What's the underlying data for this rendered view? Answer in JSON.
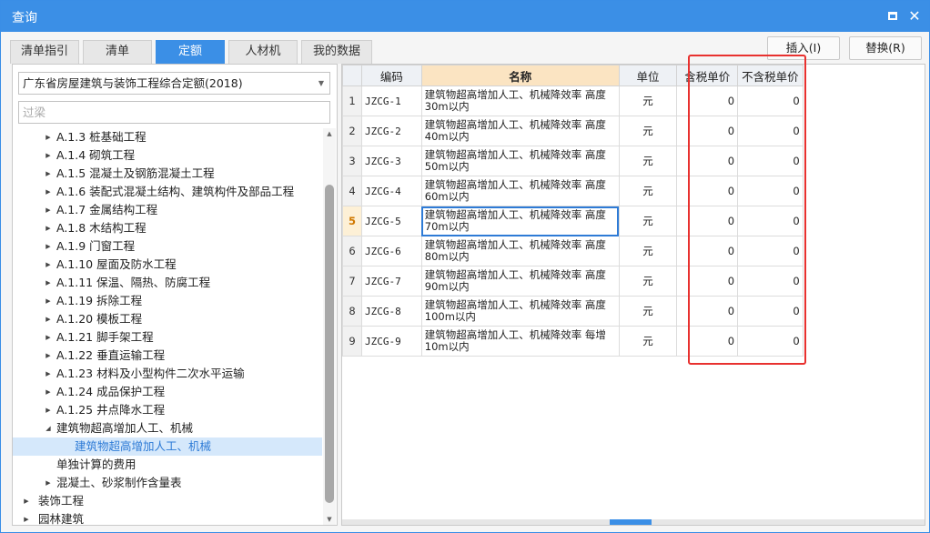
{
  "window": {
    "title": "查询"
  },
  "tabs": [
    {
      "label": "清单指引",
      "active": false
    },
    {
      "label": "清单",
      "active": false
    },
    {
      "label": "定额",
      "active": true
    },
    {
      "label": "人材机",
      "active": false
    },
    {
      "label": "我的数据",
      "active": false
    }
  ],
  "actions": {
    "insert_label": "插入(I)",
    "replace_label": "替换(R)"
  },
  "left": {
    "library": "广东省房屋建筑与装饰工程综合定额(2018)",
    "filter_placeholder": "过梁"
  },
  "tree": [
    {
      "label": "A.1.3 桩基础工程",
      "state": "collapsed"
    },
    {
      "label": "A.1.4 砌筑工程",
      "state": "collapsed"
    },
    {
      "label": "A.1.5 混凝土及钢筋混凝土工程",
      "state": "collapsed"
    },
    {
      "label": "A.1.6 装配式混凝土结构、建筑构件及部品工程",
      "state": "collapsed"
    },
    {
      "label": "A.1.7 金属结构工程",
      "state": "collapsed"
    },
    {
      "label": "A.1.8 木结构工程",
      "state": "collapsed"
    },
    {
      "label": "A.1.9 门窗工程",
      "state": "collapsed"
    },
    {
      "label": "A.1.10 屋面及防水工程",
      "state": "collapsed"
    },
    {
      "label": "A.1.11 保温、隔热、防腐工程",
      "state": "collapsed"
    },
    {
      "label": "A.1.19 拆除工程",
      "state": "collapsed"
    },
    {
      "label": "A.1.20 模板工程",
      "state": "collapsed"
    },
    {
      "label": "A.1.21 脚手架工程",
      "state": "collapsed"
    },
    {
      "label": "A.1.22 垂直运输工程",
      "state": "collapsed"
    },
    {
      "label": "A.1.23 材料及小型构件二次水平运输",
      "state": "collapsed"
    },
    {
      "label": "A.1.24 成品保护工程",
      "state": "collapsed"
    },
    {
      "label": "A.1.25 井点降水工程",
      "state": "collapsed"
    },
    {
      "label": "建筑物超高增加人工、机械",
      "state": "expanded"
    },
    {
      "label": "建筑物超高增加人工、机械",
      "state": "selected"
    },
    {
      "label": "单独计算的费用",
      "state": "leaf"
    },
    {
      "label": "混凝土、砂浆制作含量表",
      "state": "collapsed"
    },
    {
      "label": "装饰工程",
      "state": "collapsed-top"
    },
    {
      "label": "园林建筑",
      "state": "collapsed-top"
    }
  ],
  "grid": {
    "headers": {
      "code": "编码",
      "name": "名称",
      "unit": "单位",
      "tax_price": "含税单价",
      "notax_price": "不含税单价"
    },
    "rows": [
      {
        "num": "1",
        "code": "JZCG-1",
        "name1": "建筑物超高增加人工、机械降效率 高度",
        "name2": "30m以内",
        "unit": "元",
        "tax": "0",
        "notax": "0"
      },
      {
        "num": "2",
        "code": "JZCG-2",
        "name1": "建筑物超高增加人工、机械降效率 高度",
        "name2": "40m以内",
        "unit": "元",
        "tax": "0",
        "notax": "0"
      },
      {
        "num": "3",
        "code": "JZCG-3",
        "name1": "建筑物超高增加人工、机械降效率 高度",
        "name2": "50m以内",
        "unit": "元",
        "tax": "0",
        "notax": "0"
      },
      {
        "num": "4",
        "code": "JZCG-4",
        "name1": "建筑物超高增加人工、机械降效率 高度",
        "name2": "60m以内",
        "unit": "元",
        "tax": "0",
        "notax": "0"
      },
      {
        "num": "5",
        "code": "JZCG-5",
        "name1": "建筑物超高增加人工、机械降效率 高度",
        "name2": "70m以内",
        "unit": "元",
        "tax": "0",
        "notax": "0",
        "active": true
      },
      {
        "num": "6",
        "code": "JZCG-6",
        "name1": "建筑物超高增加人工、机械降效率 高度",
        "name2": "80m以内",
        "unit": "元",
        "tax": "0",
        "notax": "0"
      },
      {
        "num": "7",
        "code": "JZCG-7",
        "name1": "建筑物超高增加人工、机械降效率 高度",
        "name2": "90m以内",
        "unit": "元",
        "tax": "0",
        "notax": "0"
      },
      {
        "num": "8",
        "code": "JZCG-8",
        "name1": "建筑物超高增加人工、机械降效率 高度",
        "name2": "100m以内",
        "unit": "元",
        "tax": "0",
        "notax": "0"
      },
      {
        "num": "9",
        "code": "JZCG-9",
        "name1": "建筑物超高增加人工、机械降效率 每增",
        "name2": "10m以内",
        "unit": "元",
        "tax": "0",
        "notax": "0"
      }
    ]
  },
  "colors": {
    "accent": "#3b8fe6",
    "header_highlight": "#fbe4c2",
    "annotation_red": "#e8312f"
  }
}
